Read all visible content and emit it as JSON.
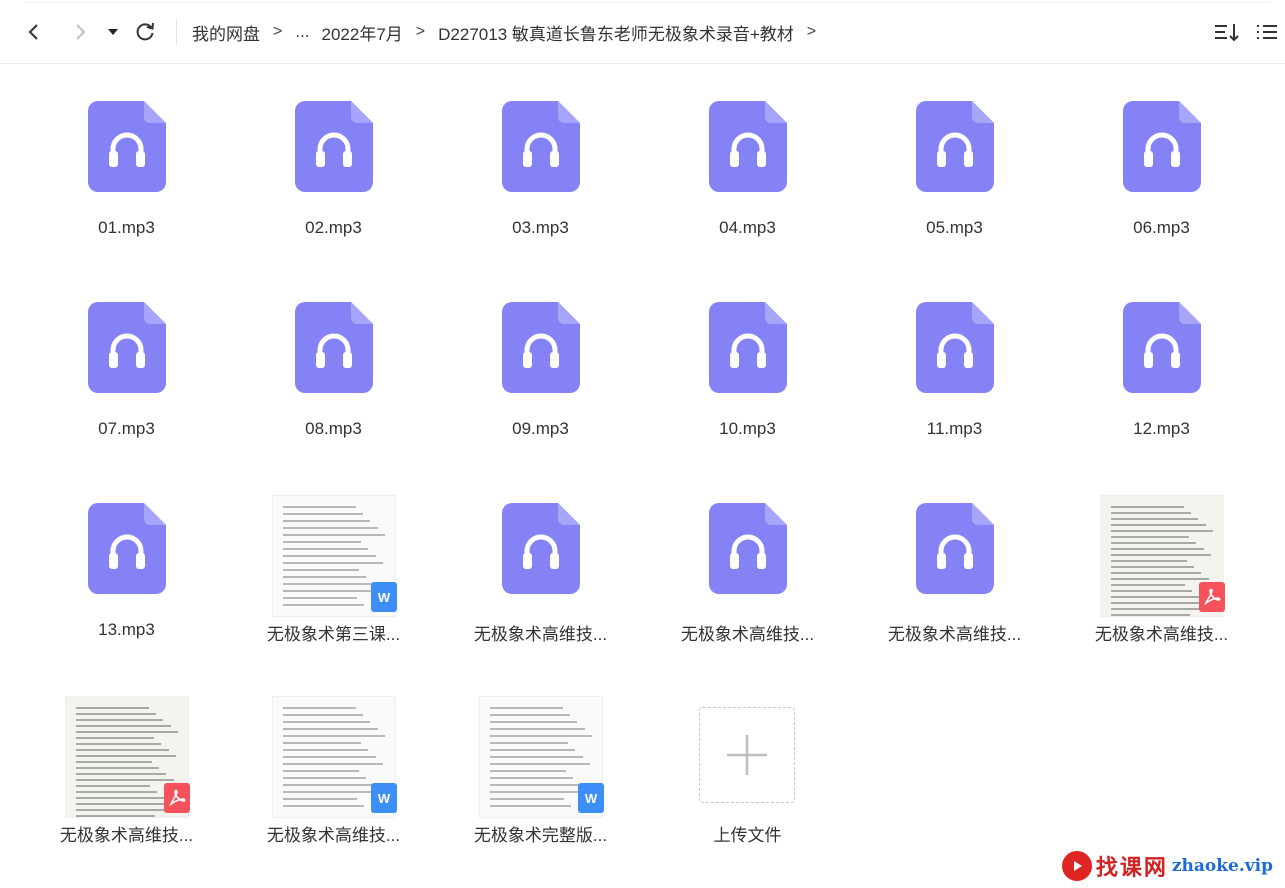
{
  "toolbar": {
    "back_icon": "chevron-left-icon",
    "forward_icon": "chevron-right-icon",
    "history_icon": "caret-down-icon",
    "refresh_icon": "refresh-icon",
    "sort_icon": "sort-icon",
    "view_icon": "list-view-icon"
  },
  "breadcrumb": {
    "root": "我的网盘",
    "ellipsis": "...",
    "folder": "2022年7月",
    "current": "D227013 敏真道长鲁东老师无极象术录音+教材",
    "separator": ">"
  },
  "files": [
    {
      "name": "01.mp3",
      "type": "audio"
    },
    {
      "name": "02.mp3",
      "type": "audio"
    },
    {
      "name": "03.mp3",
      "type": "audio"
    },
    {
      "name": "04.mp3",
      "type": "audio"
    },
    {
      "name": "05.mp3",
      "type": "audio"
    },
    {
      "name": "06.mp3",
      "type": "audio"
    },
    {
      "name": "07.mp3",
      "type": "audio"
    },
    {
      "name": "08.mp3",
      "type": "audio"
    },
    {
      "name": "09.mp3",
      "type": "audio"
    },
    {
      "name": "10.mp3",
      "type": "audio"
    },
    {
      "name": "11.mp3",
      "type": "audio"
    },
    {
      "name": "12.mp3",
      "type": "audio"
    },
    {
      "name": "13.mp3",
      "type": "audio"
    },
    {
      "name": "无极象术第三课...",
      "type": "word"
    },
    {
      "name": "无极象术高维技...",
      "type": "audio"
    },
    {
      "name": "无极象术高维技...",
      "type": "audio"
    },
    {
      "name": "无极象术高维技...",
      "type": "audio"
    },
    {
      "name": "无极象术高维技...",
      "type": "pdf"
    },
    {
      "name": "无极象术高维技...",
      "type": "pdf"
    },
    {
      "name": "无极象术高维技...",
      "type": "word"
    },
    {
      "name": "无极象术完整版...",
      "type": "word"
    }
  ],
  "upload": {
    "label": "上传文件",
    "icon": "plus-icon"
  },
  "watermark": {
    "cn": "找课网",
    "en": "zhaoke.vip"
  },
  "colors": {
    "audio_icon": "#8582f6",
    "word_badge": "#3e8ef7",
    "pdf_badge": "#f5525c"
  }
}
